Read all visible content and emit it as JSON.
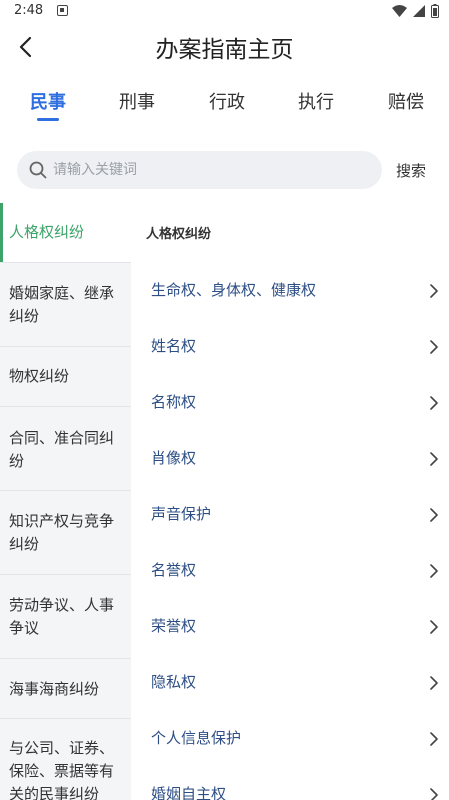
{
  "status_bar": {
    "time": "2:48"
  },
  "header": {
    "title": "办案指南主页"
  },
  "tabs": [
    {
      "label": "民事",
      "active": true
    },
    {
      "label": "刑事",
      "active": false
    },
    {
      "label": "行政",
      "active": false
    },
    {
      "label": "执行",
      "active": false
    },
    {
      "label": "赔偿",
      "active": false
    }
  ],
  "search": {
    "placeholder": "请输入关键词",
    "value": "",
    "button_label": "搜索"
  },
  "categories": [
    {
      "label": "人格权纠纷",
      "active": true
    },
    {
      "label": "婚姻家庭、继承纠纷",
      "active": false
    },
    {
      "label": "物权纠纷",
      "active": false
    },
    {
      "label": "合同、准合同纠纷",
      "active": false
    },
    {
      "label": "知识产权与竞争纠纷",
      "active": false
    },
    {
      "label": "劳动争议、人事争议",
      "active": false
    },
    {
      "label": "海事海商纠纷",
      "active": false
    },
    {
      "label": "与公司、证券、保险、票据等有关的民事纠纷",
      "active": false
    }
  ],
  "content": {
    "section_title": "人格权纠纷",
    "items": [
      "生命权、身体权、健康权",
      "姓名权",
      "名称权",
      "肖像权",
      "声音保护",
      "名誉权",
      "荣誉权",
      "隐私权",
      "个人信息保护",
      "婚姻自主权"
    ]
  },
  "colors": {
    "tab_active": "#2f6fe0",
    "category_active": "#3da36a",
    "item_text": "#2e4f86"
  }
}
